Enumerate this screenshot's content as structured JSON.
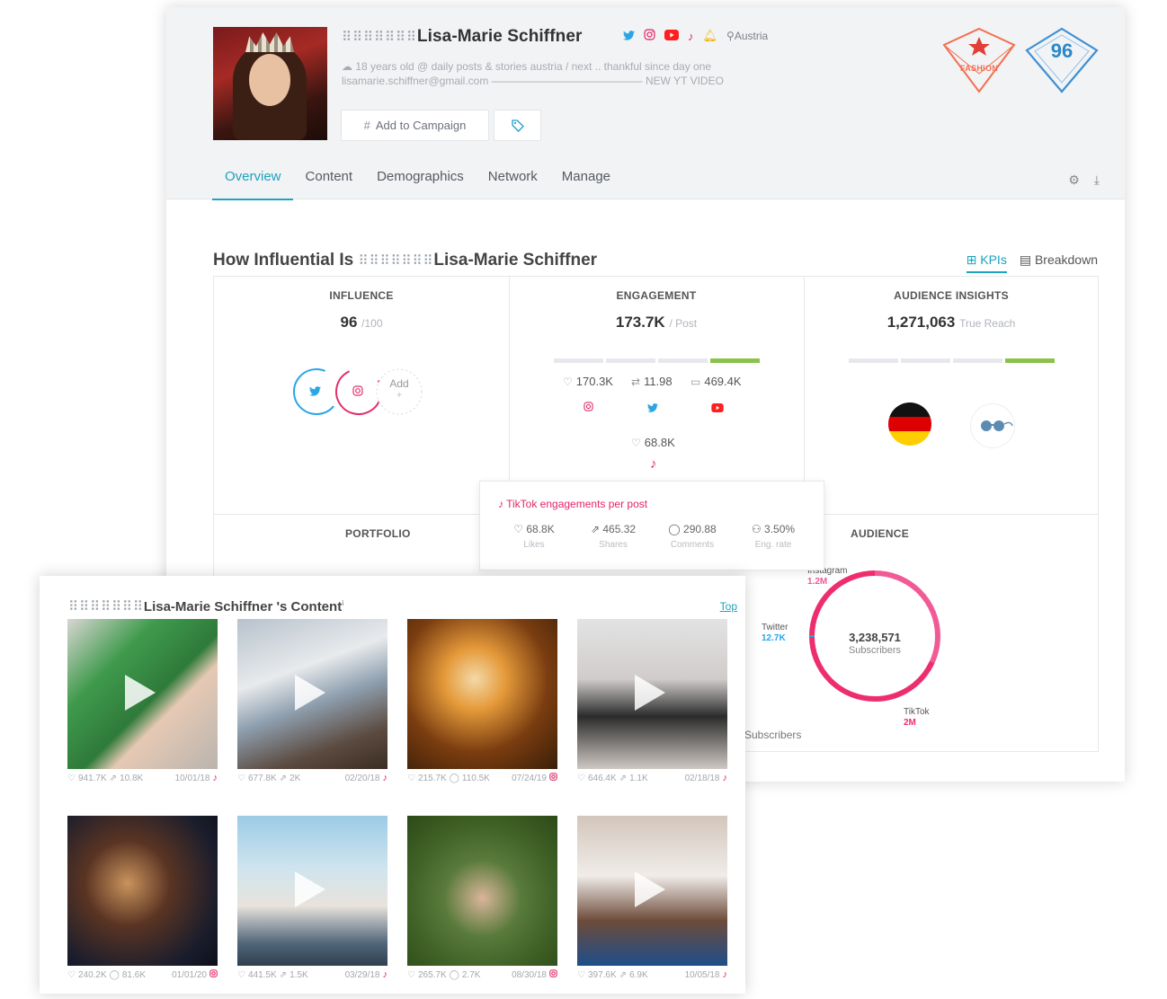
{
  "profile": {
    "dots": "⠿⠿⠿⠿⠿⠿⠿",
    "name": "Lisa-Marie Schiffner",
    "location": "Austria",
    "bio_line1": "18 years old @ daily posts & stories austria / next .. thankful since day one",
    "bio_line2": "lisamarie.schiffner@gmail.com —————————————— NEW YT VIDEO",
    "add_campaign_label": "Add to Campaign",
    "category_badge": "FASHION",
    "score_badge": "96"
  },
  "tabs": [
    "Overview",
    "Content",
    "Demographics",
    "Network",
    "Manage"
  ],
  "section": {
    "title_prefix": "How Influential Is",
    "kpis_label": "KPIs",
    "breakdown_label": "Breakdown"
  },
  "influence": {
    "label": "INFLUENCE",
    "value": "96",
    "unit": "/100",
    "add_label": "Add"
  },
  "engagement": {
    "label": "ENGAGEMENT",
    "value": "173.7K",
    "unit": "/ Post",
    "instagram": "170.3K",
    "twitter": "11.98",
    "youtube": "469.4K",
    "tiktok": "68.8K"
  },
  "audience_insights": {
    "label": "AUDIENCE INSIGHTS",
    "value": "1,271,063",
    "unit": "True Reach"
  },
  "portfolio": {
    "label": "PORTFOLIO"
  },
  "audience": {
    "label": "AUDIENCE",
    "total": "3,238,571",
    "total_label": "Subscribers",
    "instagram_label": "Instagram",
    "instagram_value": "1.2M",
    "twitter_label": "Twitter",
    "twitter_value": "12.7K",
    "tiktok_label": "TikTok",
    "tiktok_value": "2M",
    "footer": "Subscribers"
  },
  "tooltip": {
    "title": "TikTok engagements per post",
    "likes": "68.8K",
    "likes_label": "Likes",
    "shares": "465.32",
    "shares_label": "Shares",
    "comments": "290.88",
    "comments_label": "Comments",
    "rate": "3.50%",
    "rate_label": "Eng. rate"
  },
  "content": {
    "title_suffix": "'s Content",
    "top_label": "Top",
    "posts": [
      {
        "likes": "941.7K",
        "second": "10.8K",
        "second_type": "shares",
        "date": "10/01/18",
        "platform": "tiktok",
        "video": true
      },
      {
        "likes": "677.8K",
        "second": "2K",
        "second_type": "shares",
        "date": "02/20/18",
        "platform": "tiktok",
        "video": true
      },
      {
        "likes": "215.7K",
        "second": "110.5K",
        "second_type": "comments",
        "date": "07/24/19",
        "platform": "instagram",
        "video": false
      },
      {
        "likes": "646.4K",
        "second": "1.1K",
        "second_type": "shares",
        "date": "02/18/18",
        "platform": "tiktok",
        "video": true
      },
      {
        "likes": "240.2K",
        "second": "81.6K",
        "second_type": "comments",
        "date": "01/01/20",
        "platform": "instagram",
        "video": false
      },
      {
        "likes": "441.5K",
        "second": "1.5K",
        "second_type": "shares",
        "date": "03/29/18",
        "platform": "tiktok",
        "video": true
      },
      {
        "likes": "265.7K",
        "second": "2.7K",
        "second_type": "comments",
        "date": "08/30/18",
        "platform": "instagram",
        "video": false
      },
      {
        "likes": "397.6K",
        "second": "6.9K",
        "second_type": "shares",
        "date": "10/05/18",
        "platform": "tiktok",
        "video": true
      }
    ]
  },
  "colors": {
    "accent": "#1ca3bd",
    "tiktok": "#e5246b",
    "instagram": "#e1306c",
    "twitter": "#2aa5e6",
    "youtube": "#ff1f1f",
    "positive": "#8bc34a"
  }
}
